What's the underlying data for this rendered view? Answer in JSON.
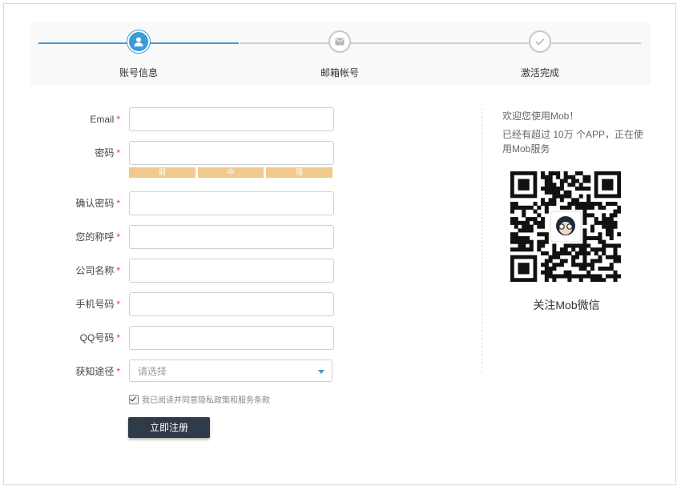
{
  "steps": [
    {
      "label": "账号信息",
      "state": "active",
      "icon": "user-icon"
    },
    {
      "label": "邮箱帐号",
      "state": "todo",
      "icon": "mail-icon"
    },
    {
      "label": "激活完成",
      "state": "todo",
      "icon": "check-icon"
    }
  ],
  "form": {
    "required_mark": "*",
    "email_label": "Email",
    "password_label": "密码",
    "strength": [
      "弱",
      "中",
      "强"
    ],
    "confirm_label": "确认密码",
    "nickname_label": "您的称呼",
    "company_label": "公司名称",
    "phone_label": "手机号码",
    "qq_label": "QQ号码",
    "source_label": "获知途径",
    "source_placeholder": "请选择",
    "agree_text": "我已阅读并同意隐私政策和服务条款",
    "agree_checked": true,
    "submit_label": "立即注册"
  },
  "side": {
    "welcome": "欢迎您使用Mob！",
    "desc": "已经有超过 10万 个APP，正在使用Mob服务",
    "qr_caption": "关注Mob微信"
  },
  "colors": {
    "accent": "#3a9bd8",
    "strength": "#f0c98c",
    "button": "#2f3b49",
    "required": "#e33333"
  }
}
